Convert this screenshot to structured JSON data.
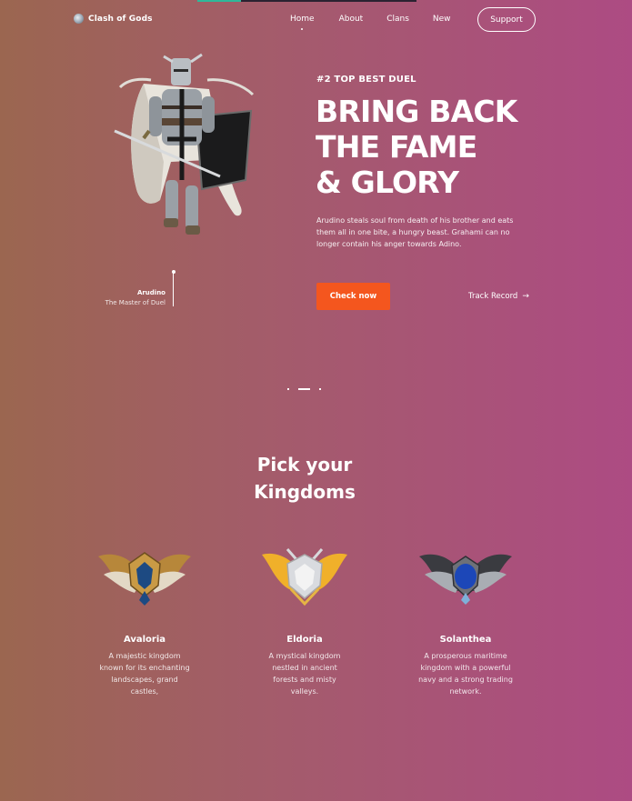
{
  "nav": {
    "brand": "Clash of Gods",
    "items": [
      "Home",
      "About",
      "Clans",
      "New"
    ],
    "active": "Home",
    "support_label": "Support"
  },
  "hero": {
    "eyebrow": "#2 TOP BEST DUEL",
    "headline": [
      "BRING BACK",
      "THE FAME",
      "& GLORY"
    ],
    "description": "Arudino steals soul from death of his brother and eats them all in one bite, a hungry beast. Grahami can no longer contain his anger towards Adino.",
    "cta_label": "Check now",
    "secondary_label": "Track Record",
    "character_name": "Arudino",
    "character_title": "The Master of Duel"
  },
  "section": {
    "title_line1": "Pick your",
    "title_line2": "Kingdoms"
  },
  "kingdoms": [
    {
      "name": "Avaloria",
      "description": "A majestic kingdom known for its enchanting landscapes, grand castles,",
      "emblem": "bronze-winged-emblem-icon"
    },
    {
      "name": "Eldoria",
      "description": "A mystical kingdom nestled in ancient forests and misty valleys.",
      "emblem": "gold-winged-emblem-icon"
    },
    {
      "name": "Solanthea",
      "description": "A prosperous maritime kingdom with a powerful navy and a strong trading network.",
      "emblem": "silver-winged-emblem-icon"
    }
  ],
  "colors": {
    "accent": "#f4561e",
    "gradient_start": "#9b6650",
    "gradient_end": "#ad4b83"
  }
}
